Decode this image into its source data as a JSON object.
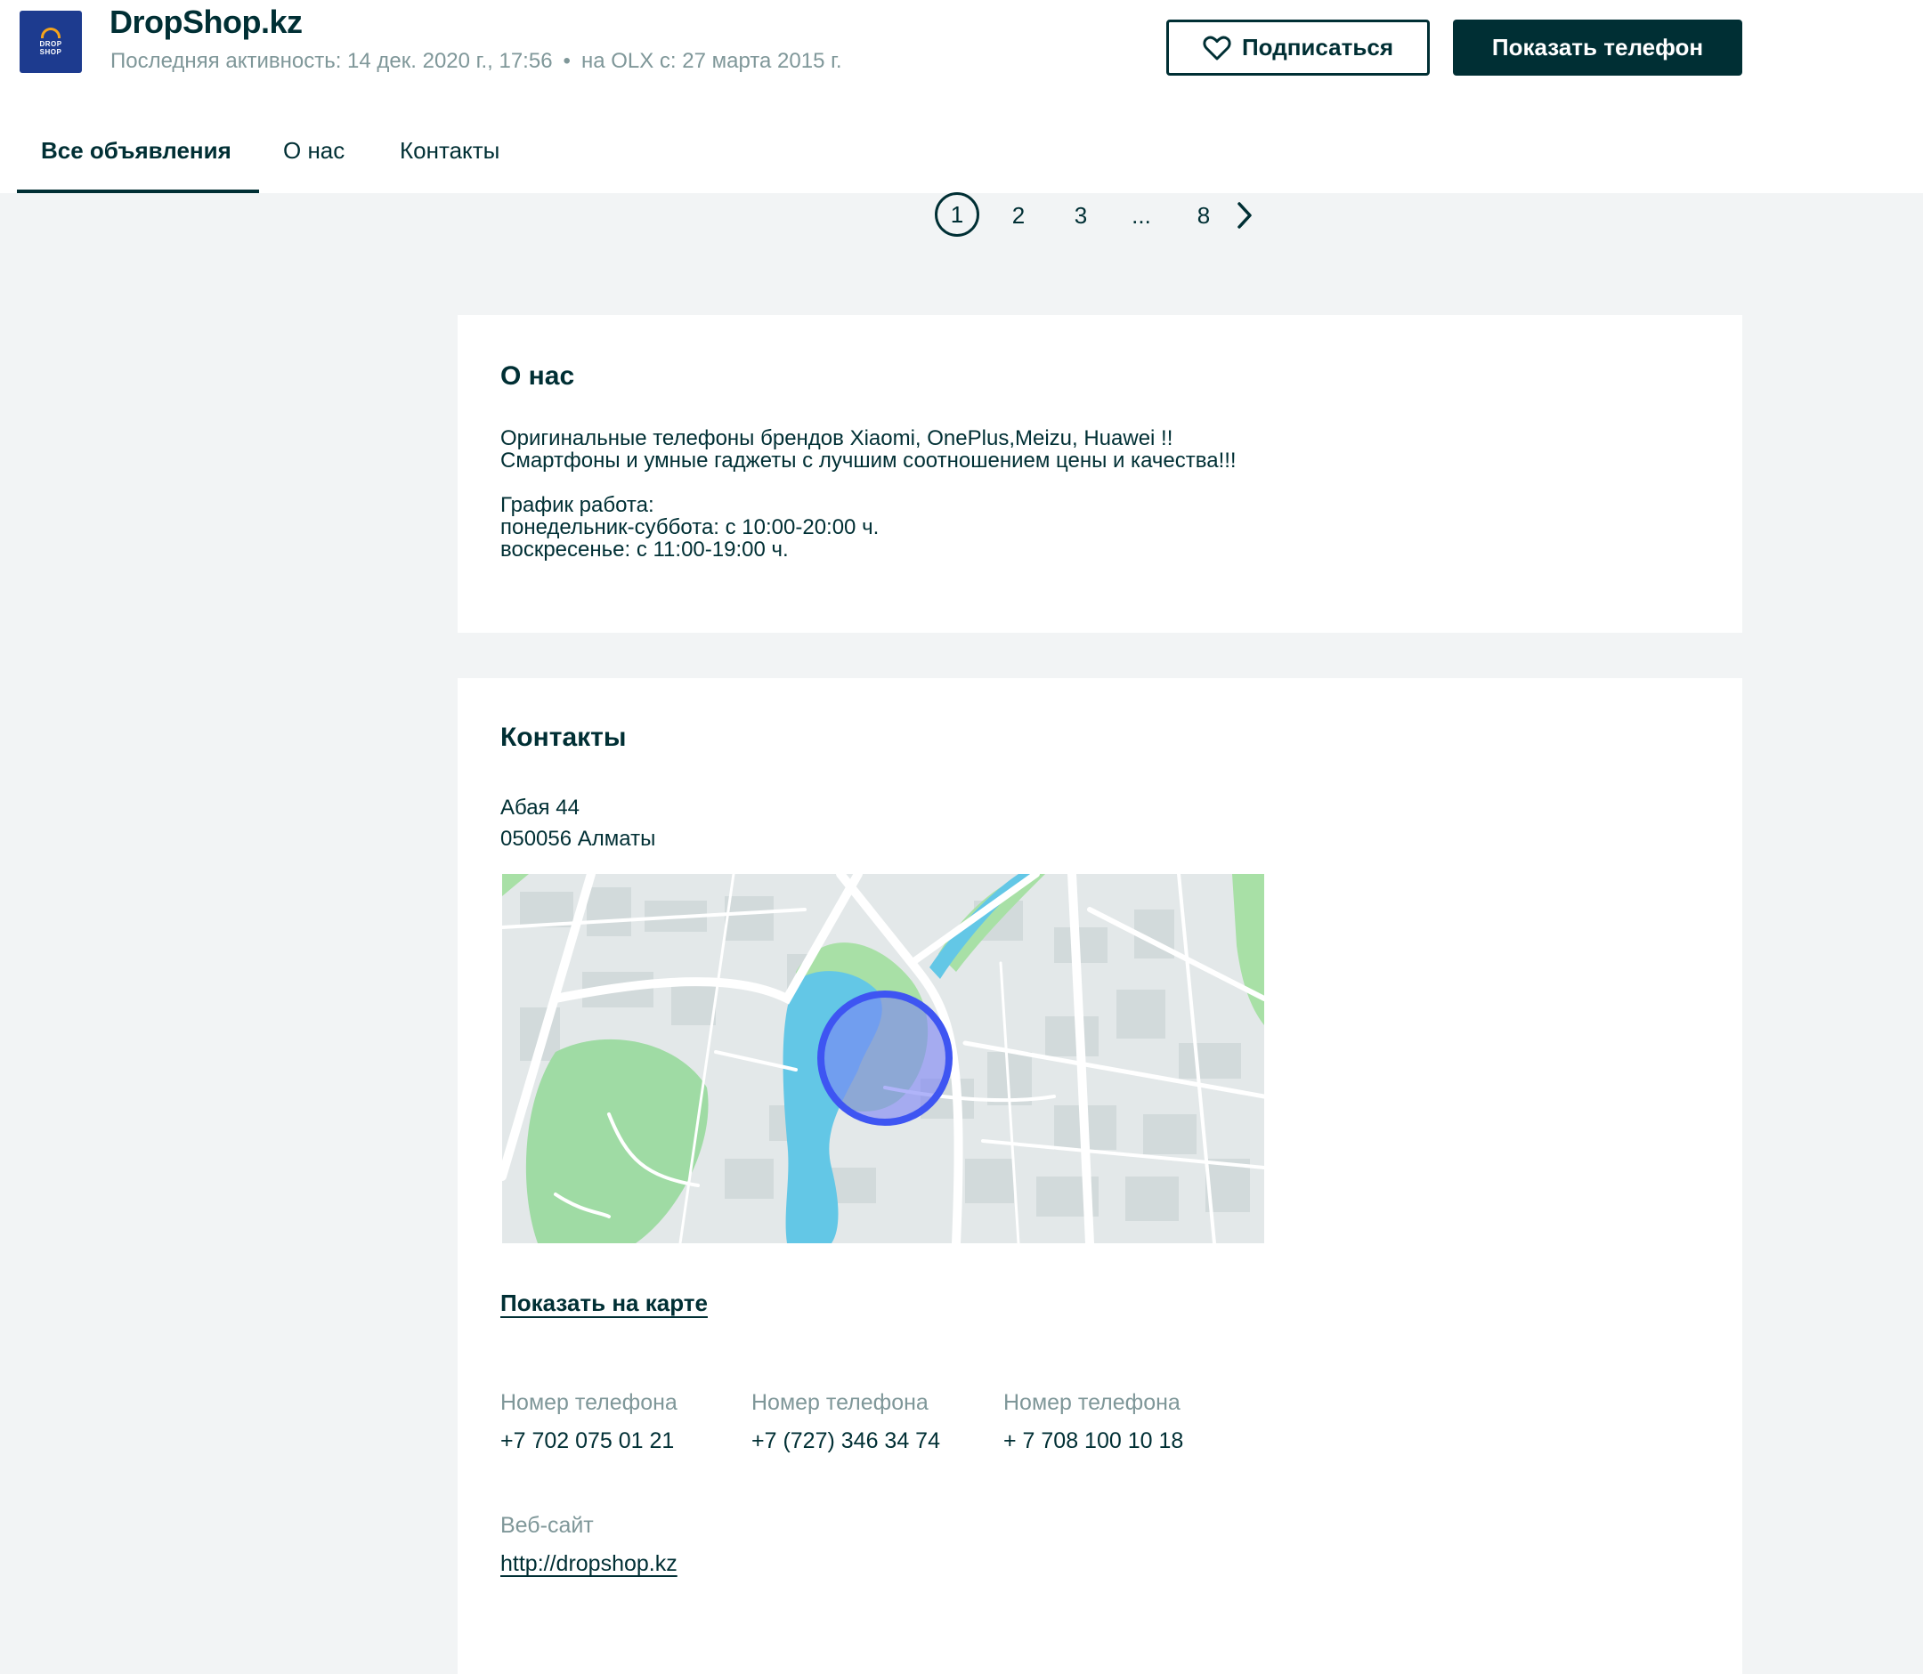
{
  "shop": {
    "logo_text": "DROP SHOP",
    "name": "DropShop.kz",
    "last_activity": "Последняя активность: 14 дек. 2020 г., 17:56",
    "bullet": "•",
    "on_olx_since": "на OLX с: 27 марта 2015 г."
  },
  "actions": {
    "follow_label": "Подписаться",
    "show_phone_label": "Показать телефон"
  },
  "tabs": [
    {
      "label": "Все объявления",
      "active": true
    },
    {
      "label": "О нас",
      "active": false
    },
    {
      "label": "Контакты",
      "active": false
    }
  ],
  "pagination": {
    "pages": [
      "1",
      "2",
      "3",
      "...",
      "8"
    ],
    "current": "1"
  },
  "about": {
    "title": "О нас",
    "text": "Оригинальные телефоны брендов Xiaomi, OnePlus,Meizu, Huawei !!\nСмартфоны и умные гаджеты с лучшим соотношением цены и качества!!!\n\nГрафик работа:\nпонедельник-суббота: с 10:00-20:00 ч.\nвоскресенье: с 11:00-19:00 ч."
  },
  "contacts": {
    "title": "Контакты",
    "address_line1": "Абая 44",
    "address_line2": "050056 Алматы",
    "map_link": "Показать на карте",
    "phones": [
      {
        "label": "Номер телефона",
        "value": "+7 702 075 01 21"
      },
      {
        "label": "Номер телефона",
        "value": "+7 (727) 346 34 74"
      },
      {
        "label": "Номер телефона",
        "value": "+ 7 708 100 10 18"
      }
    ],
    "website_label": "Веб-сайт",
    "website_url": "http://dropshop.kz"
  },
  "colors": {
    "primary": "#002f34",
    "muted": "#7f9799",
    "page_bg": "#f2f4f5",
    "logo_bg": "#1d3b8f",
    "map_marker": "#4a5cf0"
  }
}
